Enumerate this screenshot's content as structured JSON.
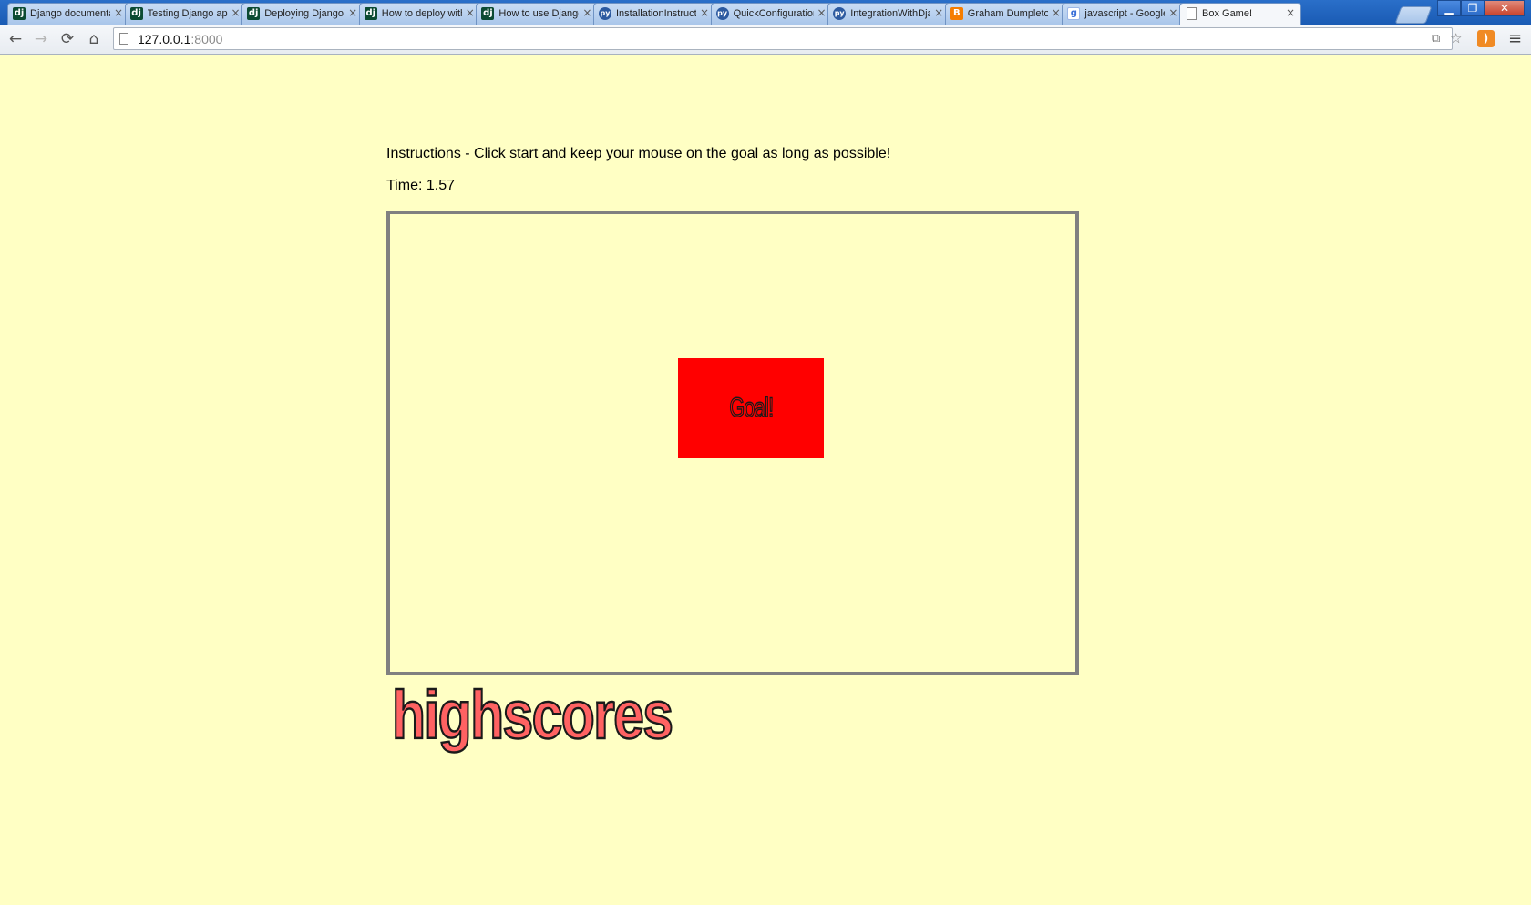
{
  "browser": {
    "tabs": [
      {
        "icon": "django-icon",
        "glyph": "dj",
        "kind": "dj",
        "label": "Django documentation"
      },
      {
        "icon": "django-icon",
        "glyph": "dj",
        "kind": "dj",
        "label": "Testing Django applications"
      },
      {
        "icon": "django-icon",
        "glyph": "dj",
        "kind": "dj",
        "label": "Deploying Django"
      },
      {
        "icon": "django-icon",
        "glyph": "dj",
        "kind": "dj",
        "label": "How to deploy with"
      },
      {
        "icon": "django-icon",
        "glyph": "dj",
        "kind": "dj",
        "label": "How to use Django"
      },
      {
        "icon": "python-icon",
        "glyph": "py",
        "kind": "py",
        "label": "InstallationInstructions"
      },
      {
        "icon": "python-icon",
        "glyph": "py",
        "kind": "py",
        "label": "QuickConfiguration"
      },
      {
        "icon": "python-icon",
        "glyph": "py",
        "kind": "py",
        "label": "IntegrationWithDjango"
      },
      {
        "icon": "blogger-icon",
        "glyph": "B",
        "kind": "bl",
        "label": "Graham Dumpleton"
      },
      {
        "icon": "google-icon",
        "glyph": "g",
        "kind": "gg",
        "label": "javascript - Google"
      },
      {
        "icon": "page-icon",
        "glyph": "",
        "kind": "pg",
        "label": "Box Game!",
        "active": true
      }
    ],
    "close_glyph": "×",
    "window": {
      "minimize": "▁",
      "maximize": "❐",
      "close": "✕"
    },
    "nav": {
      "back": "←",
      "forward": "→",
      "reload": "⟳",
      "home": "⌂"
    },
    "address": {
      "host": "127.0.0.1",
      "port": ":8000"
    },
    "bookmark_star": "☆",
    "page_action": "⧉",
    "rss": ")",
    "menu": "≡"
  },
  "page": {
    "instructions": "Instructions - Click start and keep your mouse on the goal as long as possible!",
    "time_label": "Time: 1.57",
    "goal_label": "Goal!",
    "highscores_label": "highscores",
    "colors": {
      "background": "#ffffc4",
      "goal": "#ff0000",
      "box_border": "#808080",
      "highscores": "#ff6262"
    }
  }
}
